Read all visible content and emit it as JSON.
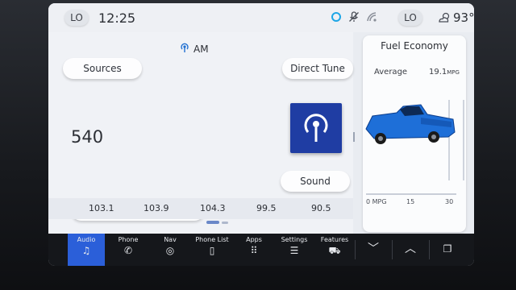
{
  "status_bar": {
    "left_temp_label": "LO",
    "clock": "12:25",
    "right_temp_label": "LO",
    "outside_temp": "93°",
    "icons": [
      "alexa-ring-icon",
      "mic-off-icon",
      "wifi-icon",
      "weather-icon"
    ]
  },
  "radio": {
    "band": "AM",
    "sources_label": "Sources",
    "direct_tune_label": "Direct Tune",
    "frequency": "540",
    "sound_label": "Sound",
    "controls": [
      "seek-back",
      "minus",
      "plus",
      "seek-forward"
    ],
    "presets": [
      "103.1",
      "103.9",
      "104.3",
      "99.5",
      "90.5"
    ]
  },
  "fuel_economy": {
    "title": "Fuel Economy",
    "average_label": "Average",
    "average_value": "19.1",
    "average_unit": "MPG",
    "gauge_labels": [
      "0 MPG",
      "15",
      "30"
    ],
    "truck_color": "#1e6fd8"
  },
  "nav": {
    "items": [
      {
        "label": "Audio",
        "icon": "music-note-icon",
        "active": true
      },
      {
        "label": "Phone",
        "icon": "phone-icon",
        "active": false
      },
      {
        "label": "Nav",
        "icon": "compass-icon",
        "active": false
      },
      {
        "label": "Phone List",
        "icon": "phone-list-icon",
        "active": false
      },
      {
        "label": "Apps",
        "icon": "apps-grid-icon",
        "active": false
      },
      {
        "label": "Settings",
        "icon": "sliders-icon",
        "active": false
      },
      {
        "label": "Features",
        "icon": "truck-icon",
        "active": false
      }
    ]
  },
  "colors": {
    "accent": "#2b5fd9",
    "station_art": "#1f3da3",
    "nav_bg": "#15171b"
  }
}
